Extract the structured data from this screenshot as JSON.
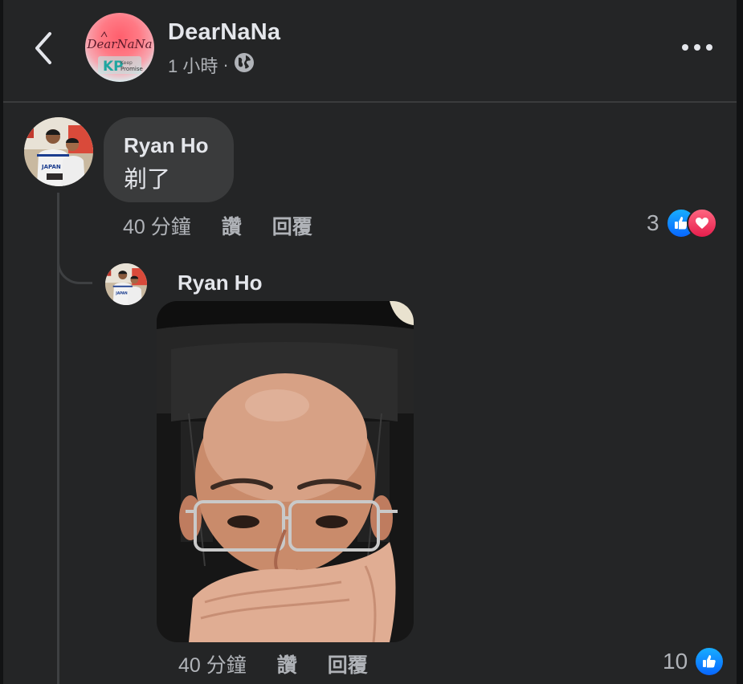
{
  "header": {
    "page_name": "DearNaNa",
    "time": "1 小時",
    "separator": "·",
    "avatar_brand_text": "DearNaNa",
    "avatar_sub_logo": "KP",
    "avatar_sub_text_1": "Keep",
    "avatar_sub_text_2": "Promise"
  },
  "comment": {
    "author": "Ryan Ho",
    "text": "剃了",
    "time": "40 分鐘",
    "like_label": "讚",
    "reply_label": "回覆",
    "reaction_count": "3",
    "avatar_shirt_text": "JAPAN"
  },
  "reply": {
    "author": "Ryan Ho",
    "time": "40 分鐘",
    "like_label": "讚",
    "reply_label": "回覆",
    "reaction_count": "10",
    "avatar_shirt_text": "JAPAN"
  },
  "colors": {
    "background": "#242526",
    "bubble": "#3a3b3c",
    "primary_text": "#e4e6eb",
    "secondary_text": "#b0b3b8",
    "like_blue": "#0866ff",
    "love_red": "#f33e58"
  },
  "icons": [
    "back-arrow-icon",
    "globe-icon",
    "more-dots-icon",
    "like-reaction-icon",
    "love-reaction-icon"
  ]
}
